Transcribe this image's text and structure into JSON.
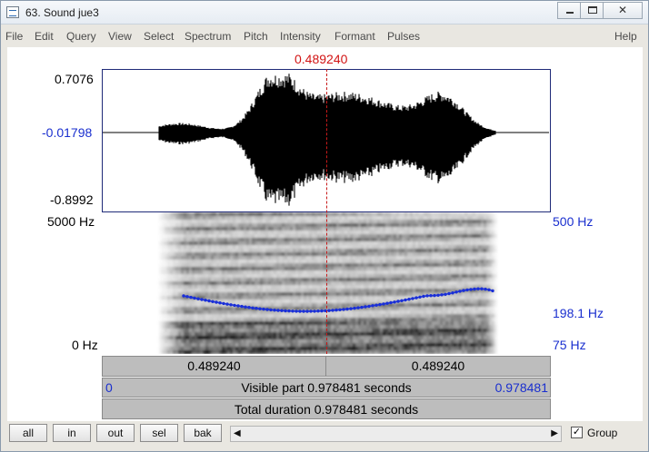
{
  "window": {
    "title": "63. Sound jue3"
  },
  "menu": [
    "File",
    "Edit",
    "Query",
    "View",
    "Select",
    "Spectrum",
    "Pitch",
    "Intensity",
    "Formant",
    "Pulses"
  ],
  "menu_help": "Help",
  "cursor_time": "0.489240",
  "waveform": {
    "max_label": "0.7076",
    "cursor_value": "-0.01798",
    "min_label": "-0.8992"
  },
  "spectrogram": {
    "freq_top": "5000 Hz",
    "freq_bottom": "0 Hz",
    "pitch_top": "500 Hz",
    "pitch_cursor": "198.1 Hz",
    "pitch_bottom": "75 Hz"
  },
  "bars": {
    "left_time": "0.489240",
    "right_time": "0.489240",
    "visible_start": "0",
    "visible_label": "Visible part 0.978481 seconds",
    "visible_end": "0.978481",
    "total_label": "Total duration 0.978481 seconds"
  },
  "buttons": {
    "all": "all",
    "in": "in",
    "out": "out",
    "sel": "sel",
    "bak": "bak"
  },
  "group": {
    "label": "Group",
    "checked": "✓"
  },
  "icons": {
    "minimize": "minimize-icon",
    "maximize": "maximize-icon",
    "close": "close-icon"
  }
}
